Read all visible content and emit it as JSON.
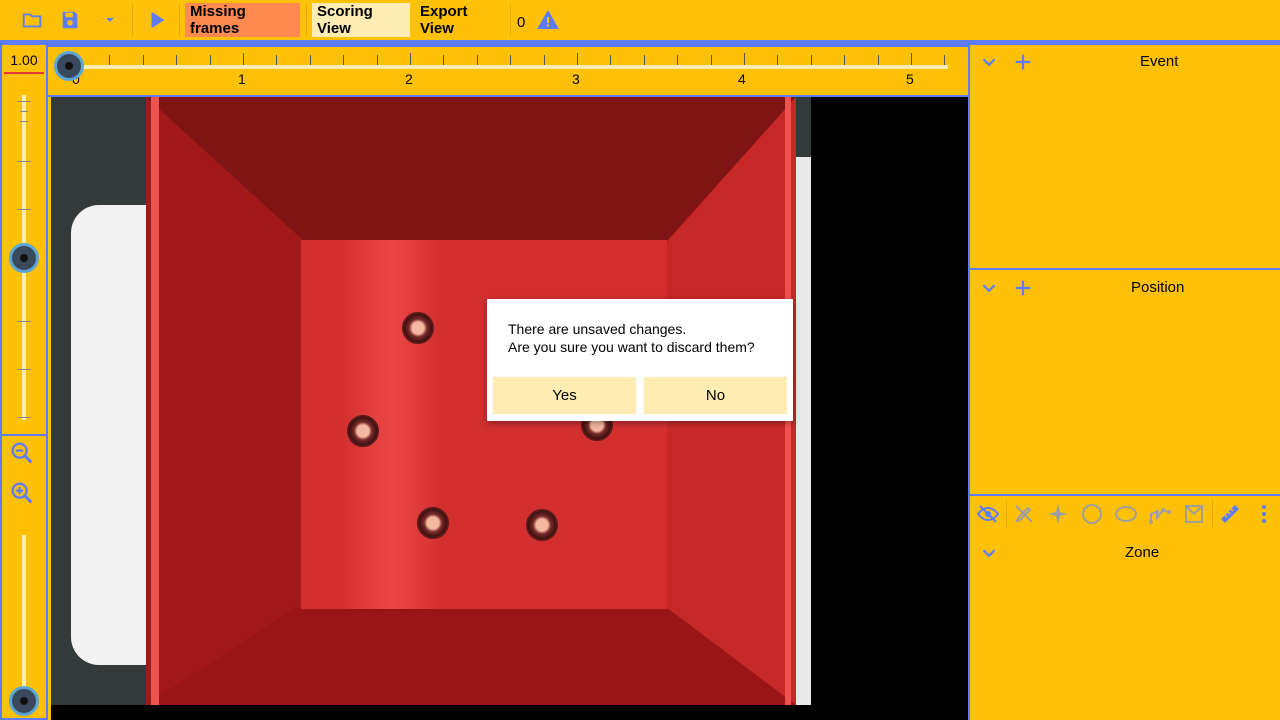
{
  "toolbar": {
    "open_icon": "folder-icon",
    "save_icon": "save-icon",
    "dropdown_icon": "caret-down-icon",
    "play_icon": "play-icon",
    "missing_frames_label": "Missing frames",
    "scoring_view_label": "Scoring View",
    "export_view_label": "Export View",
    "warning_count": "0",
    "warning_icon": "warning-icon"
  },
  "zoom": {
    "value": "1.00",
    "zoom_out_icon": "zoom-out-icon",
    "zoom_in_icon": "zoom-in-icon"
  },
  "timeline": {
    "labels": [
      "0",
      "1",
      "2",
      "3",
      "4",
      "5"
    ]
  },
  "dialog": {
    "line1": "There are unsaved changes.",
    "line2": "Are you sure you want to discard them?",
    "yes_label": "Yes",
    "no_label": "No"
  },
  "sidebar": {
    "event_title": "Event",
    "position_title": "Position",
    "zone_title": "Zone",
    "zone_tools": [
      "visibility-off-icon",
      "pen-off-icon",
      "sparkle-icon",
      "circle-icon",
      "ellipse-icon",
      "polyline-icon",
      "polygon-icon",
      "ruler-icon",
      "more-vert-icon"
    ]
  },
  "colors": {
    "background": "#ffc107",
    "accent": "#5c7cfa",
    "highlight": "#ff8a50",
    "button_light": "#ffecb3"
  }
}
